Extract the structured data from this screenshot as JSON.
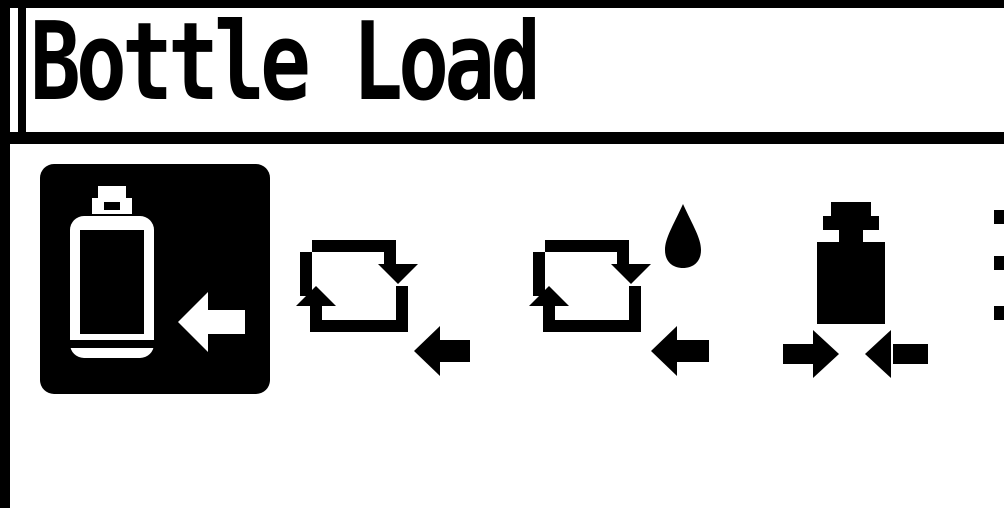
{
  "screen": {
    "title": "Bottle Load"
  },
  "menu": {
    "items": [
      {
        "icon": "bottle-load-icon",
        "selected": true
      },
      {
        "icon": "circulate-load-icon",
        "selected": false
      },
      {
        "icon": "circulate-drop-load-icon",
        "selected": false
      },
      {
        "icon": "weight-compress-icon",
        "selected": false
      },
      {
        "icon": "more-options-icon",
        "selected": false
      }
    ]
  },
  "colors": {
    "foreground": "#000000",
    "background": "#ffffff"
  }
}
